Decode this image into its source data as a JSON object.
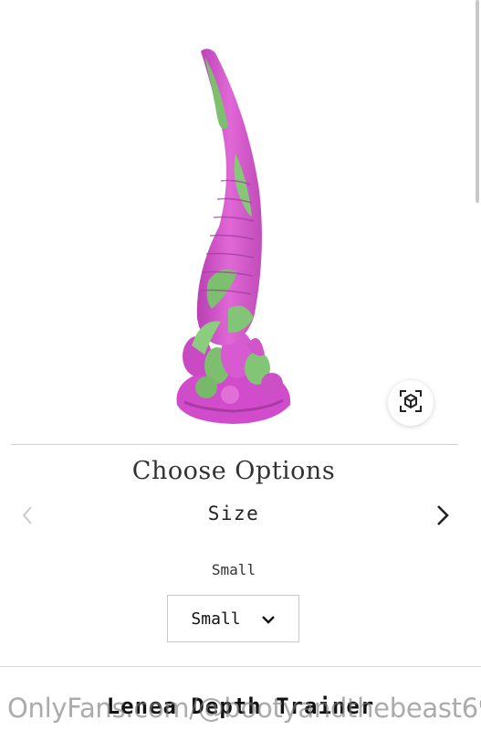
{
  "options": {
    "title": "Choose Options",
    "option_name": "Size",
    "selected_value_label": "Small",
    "select_value": "Small"
  },
  "product": {
    "name": "Lenea Depth Trainer"
  },
  "watermark": {
    "text": "OnlyFans.com/@bootyandthebeast69"
  },
  "icons": {
    "ar_view": "ar-cube-icon",
    "prev": "chevron-left-icon",
    "next": "chevron-right-icon",
    "dropdown": "chevron-down-icon"
  },
  "colors": {
    "product_pink": "#d64fcf",
    "product_green": "#7dbf6f",
    "divider": "#cfcfcf",
    "nav_disabled": "#c9c9c9"
  }
}
